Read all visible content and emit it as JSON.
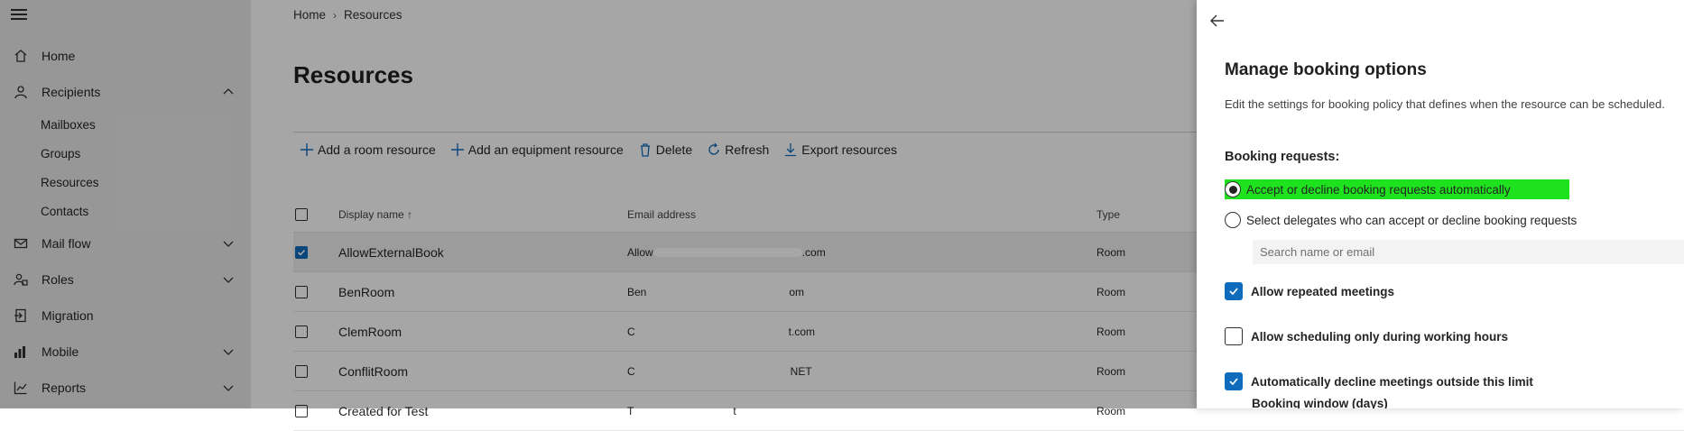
{
  "sidebar": {
    "items": [
      {
        "label": "Home",
        "icon": "home-icon"
      },
      {
        "label": "Recipients",
        "icon": "person-icon"
      },
      {
        "label": "Mail flow",
        "icon": "mail-icon"
      },
      {
        "label": "Roles",
        "icon": "roles-icon"
      },
      {
        "label": "Migration",
        "icon": "migration-icon"
      },
      {
        "label": "Mobile",
        "icon": "mobile-icon"
      },
      {
        "label": "Reports",
        "icon": "reports-icon"
      }
    ],
    "recipients_sub": [
      "Mailboxes",
      "Groups",
      "Resources",
      "Contacts"
    ]
  },
  "breadcrumb": {
    "home": "Home",
    "current": "Resources"
  },
  "page": {
    "title": "Resources"
  },
  "toolbar": {
    "add_room": "Add a room resource",
    "add_equipment": "Add an equipment resource",
    "delete": "Delete",
    "refresh": "Refresh",
    "export": "Export resources"
  },
  "table": {
    "headers": {
      "name": "Display name",
      "email": "Email address",
      "type": "Type"
    },
    "rows": [
      {
        "name": "AllowExternalBook",
        "email_start": "Allow",
        "email_end": ".com",
        "type": "Room",
        "selected": true
      },
      {
        "name": "BenRoom",
        "email_start": "Ben",
        "email_end": "om",
        "type": "Room",
        "selected": false
      },
      {
        "name": "ClemRoom",
        "email_start": "C",
        "email_end": "t.com",
        "type": "Room",
        "selected": false
      },
      {
        "name": "ConflitRoom",
        "email_start": "C",
        "email_end": "NET",
        "type": "Room",
        "selected": false
      },
      {
        "name": "Created for Test",
        "email_start": "T",
        "email_end": "t",
        "type": "Room",
        "selected": false
      }
    ]
  },
  "panel": {
    "title": "Manage booking options",
    "description": "Edit the settings for booking policy that defines when the resource can be scheduled.",
    "section": "Booking requests:",
    "radio_auto": "Accept or decline booking requests automatically",
    "radio_delegates": "Select delegates who can accept or decline booking requests",
    "search_placeholder": "Search name or email",
    "allow_repeated": "Allow repeated meetings",
    "working_hours": "Allow scheduling only during working hours",
    "auto_decline": "Automatically decline meetings outside this limit",
    "booking_window": "Booking window (days)",
    "highlight_color": "#1ee21e",
    "accent_color": "#0f6cbd"
  }
}
